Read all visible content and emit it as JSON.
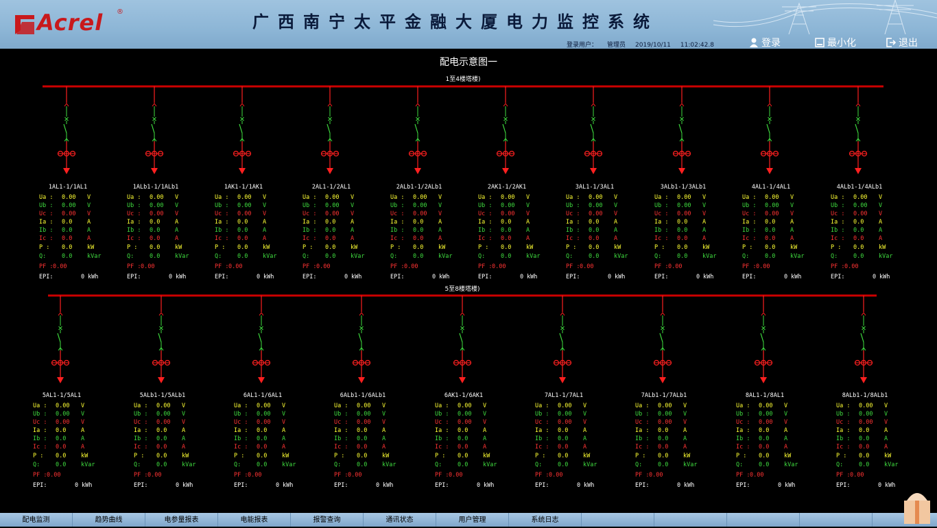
{
  "header": {
    "logo_text": "Acrel",
    "logo_reg": "®",
    "title": "广西南宁太平金融大厦电力监控系统",
    "login_user_label": "登录用户：",
    "user_name": "管理员",
    "date": "2019/10/11",
    "time": "11:02:42.8",
    "buttons": {
      "login": "登录",
      "minimize": "最小化",
      "exit": "退出"
    }
  },
  "page_title": "配电示意图一",
  "buses": [
    {
      "label": "1至4楼塔楼)",
      "panels": [
        {
          "name": "1AL1-1/1AL1"
        },
        {
          "name": "1ALb1-1/1ALb1"
        },
        {
          "name": "1AK1-1/1AK1"
        },
        {
          "name": "2AL1-1/2AL1"
        },
        {
          "name": "2ALb1-1/2ALb1"
        },
        {
          "name": "2AK1-1/2AK1"
        },
        {
          "name": "3AL1-1/3AL1"
        },
        {
          "name": "3ALb1-1/3ALb1"
        },
        {
          "name": "4AL1-1/4AL1"
        },
        {
          "name": "4ALb1-1/4ALb1"
        }
      ]
    },
    {
      "label": "5至8楼塔楼)",
      "panels": [
        {
          "name": "5AL1-1/5AL1"
        },
        {
          "name": "5ALb1-1/5ALb1"
        },
        {
          "name": "6AL1-1/6AL1"
        },
        {
          "name": "6ALb1-1/6ALb1"
        },
        {
          "name": "6AK1-1/6AK1"
        },
        {
          "name": "7AL1-1/7AL1"
        },
        {
          "name": "7ALb1-1/7ALb1"
        },
        {
          "name": "8AL1-1/8AL1"
        },
        {
          "name": "8ALb1-1/8ALb1"
        }
      ]
    }
  ],
  "measurements": [
    {
      "label": "Ua :",
      "value": "0.00",
      "unit": "V",
      "color": "yel"
    },
    {
      "label": "Ub :",
      "value": "0.00",
      "unit": "V",
      "color": "grn"
    },
    {
      "label": "Uc :",
      "value": "0.00",
      "unit": "V",
      "color": "red"
    },
    {
      "label": "Ia :",
      "value": "0.0",
      "unit": "A",
      "color": "yel"
    },
    {
      "label": "Ib :",
      "value": "0.0",
      "unit": "A",
      "color": "grn"
    },
    {
      "label": "Ic :",
      "value": "0.0",
      "unit": "A",
      "color": "red"
    },
    {
      "label": "P :",
      "value": "0.0",
      "unit": "kW",
      "color": "yel"
    },
    {
      "label": "Q:",
      "value": "0.0",
      "unit": "kVar",
      "color": "grn"
    },
    {
      "label": "PF :",
      "value": "0.00",
      "unit": "",
      "color": "red"
    },
    {
      "label": "EPI:",
      "value": "0",
      "unit": "kWh",
      "color": "wht"
    }
  ],
  "colors": {
    "bus": "#cc0000",
    "header_bg": "#8db6d6",
    "logo": "#c8191c",
    "breaker": "#ff2020",
    "switch": "#3fdc3f"
  },
  "nav_tabs": [
    "配电监测",
    "趋势曲线",
    "电参量报表",
    "电能报表",
    "报警查询",
    "通讯状态",
    "用户管理",
    "系统日志",
    "",
    "",
    "",
    ""
  ]
}
